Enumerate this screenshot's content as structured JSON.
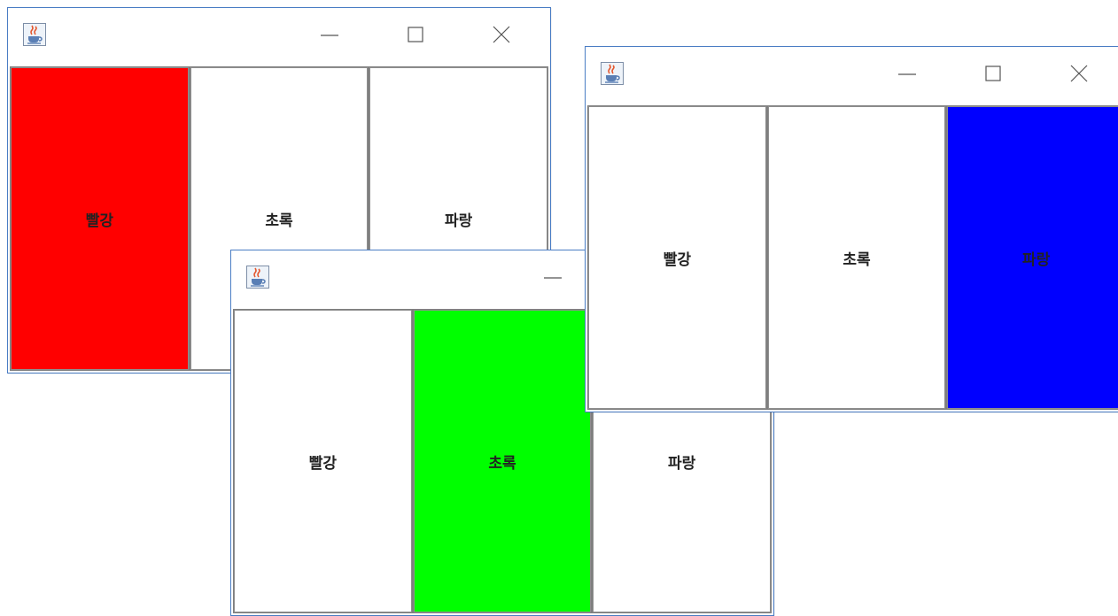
{
  "windows": [
    {
      "buttons": [
        {
          "label": "빨강",
          "active": true
        },
        {
          "label": "초록",
          "active": false
        },
        {
          "label": "파랑",
          "active": false
        }
      ]
    },
    {
      "buttons": [
        {
          "label": "빨강",
          "active": false
        },
        {
          "label": "초록",
          "active": true
        },
        {
          "label": "파랑",
          "active": false
        }
      ]
    },
    {
      "buttons": [
        {
          "label": "빨강",
          "active": false
        },
        {
          "label": "초록",
          "active": false
        },
        {
          "label": "파랑",
          "active": true
        }
      ]
    }
  ],
  "colors": {
    "red": "#ff0000",
    "green": "#00ff00",
    "blue": "#0000ff",
    "inactive": "#ffffff"
  },
  "icons": {
    "app": "java-coffee-cup-icon",
    "minimize": "minimize-icon",
    "maximize": "maximize-icon",
    "close": "close-icon"
  }
}
